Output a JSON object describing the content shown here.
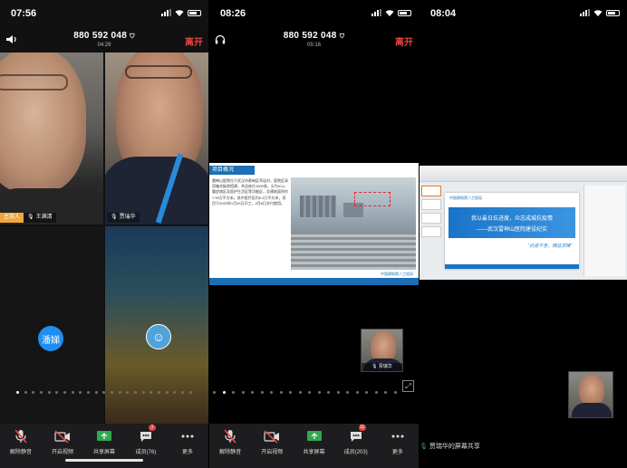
{
  "phone1": {
    "status_time": "07:56",
    "meeting_id": "880 592 048",
    "duration": "04:29",
    "leave_label": "离开",
    "host_badge": "主持人",
    "tile_names": [
      "王满清",
      "贾瑞华"
    ],
    "avatar_text": "潘娣",
    "toolbar": {
      "mute": "解除静音",
      "video": "开启视频",
      "share": "共享屏幕",
      "members": "成员(76)",
      "more": "更多"
    }
  },
  "phone2": {
    "status_time": "08:26",
    "meeting_id": "880 592 048",
    "duration": "05:16",
    "leave_label": "离开",
    "slide_title": "项目概况",
    "slide_body": "雷神山医院位于武汉市蔡甸区军运村，医院区采用箱式板房搭建，共设床位1500张，分为ICU、重症病区及医护生活区等功能区，总建筑面积约7.99万平方米，其中医疗区约6.3万平方米，项目于2020年1月26日开工，2月6日交付使用。",
    "slide_footer": "中国建筑第八工程局",
    "self_name": "贾瑞华",
    "toolbar": {
      "mute": "解除静音",
      "video": "开启视频",
      "share": "共享屏幕",
      "members": "成员(203)",
      "more": "更多"
    }
  },
  "phone3": {
    "status_time": "08:04",
    "slide_logo": "中国建筑第八工程局",
    "slide_title1": "我以最日抗进度，众志成城抗疫情",
    "slide_title2": "——武汉雷神山医院建设纪实",
    "slide_slogan": "“抗疫不息，精益求精”",
    "share_caption": "贾瑞华的屏幕共享"
  },
  "badges": {
    "phone1_members": "1",
    "phone2_members": "11"
  },
  "colors": {
    "leave_red": "#f04343",
    "host_orange": "#f3a73a",
    "avatar_blue": "#1f8ef1"
  }
}
